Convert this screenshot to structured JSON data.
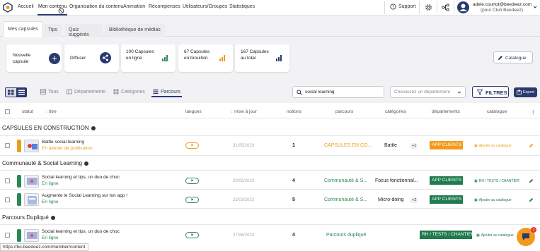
{
  "nav": {
    "links": [
      "Accueil",
      "Mon contenu",
      "Organisation du contenu",
      "Animation",
      "Récompenses",
      "Utilisateurs/Groupes",
      "Statistiques"
    ],
    "support": "Support",
    "user_email": "adele.courtot@beedeez.com",
    "user_club": "(pour Club Beedeez)"
  },
  "tabs": [
    "Mes capsules",
    "Tips",
    "Quiz suggérés",
    "Bibliothèque de médias"
  ],
  "cards": {
    "new_capsule": "Nouvelle capsule",
    "diffuser": "Diffuser",
    "online": "100 Capsules en ligne",
    "draft": "67 Capsules en brouillon",
    "total": "167 Capsules au total",
    "catalogue_btn": "Catalogue"
  },
  "filters": {
    "tabs": [
      "Tous",
      "Départements",
      "Catégories",
      "Parcours"
    ],
    "search_value": "social learning",
    "dept_placeholder": "Choisissez un département",
    "filtres_btn": "FILTRES",
    "export_btn": "Export"
  },
  "table": {
    "headers": [
      "statut",
      "titre",
      "langues",
      "mise à jour",
      "notions",
      "parcours",
      "catégories",
      "départements",
      "catalogue"
    ],
    "sections": [
      {
        "name": "CAPSULES EN CONSTRUCTION",
        "rows": [
          {
            "title": "Battle social learning",
            "status": "En attente de publication",
            "date": "31/05/2023",
            "notions": "1",
            "parcours": "CAPSULES EN CO...",
            "categorie": "Battle",
            "cat_more": "+1",
            "dept": "APP CLIENTS",
            "catalog": "Ajouter au catalogue"
          }
        ]
      },
      {
        "name": "Communauté & Social Learning",
        "rows": [
          {
            "title": "Social learning et tips, un duo de choc",
            "status": "En ligne",
            "date": "30/05/2023",
            "notions": "4",
            "parcours": "Communauté & S...",
            "categorie": "Focus fonctionnal...",
            "cat_more": "",
            "dept": "APP CLIENTS",
            "catalog": "RH / TESTS / CHANTIER"
          },
          {
            "title": "Augmente le Social Learning sur ton app !",
            "status": "En ligne",
            "date": "23/03/2023",
            "notions": "5",
            "parcours": "Communauté & S...",
            "categorie": "Micro-doing",
            "cat_more": "+2",
            "dept": "APP CLIENTS",
            "catalog": "Ajouter au catalogue"
          }
        ]
      },
      {
        "name": "Parcours Dupliqué",
        "rows": [
          {
            "title": "Social learning et tips, un duo de choc",
            "status": "En ligne",
            "date": "27/06/2023",
            "notions": "4",
            "parcours": "Parcours dupliqué",
            "categorie": "",
            "cat_more": "",
            "dept": "RH / TESTS / CHANTIER",
            "catalog": "Ajouter au catalogue"
          }
        ]
      }
    ]
  },
  "statusbar": "https://bo.beedeez.com/member/content",
  "chat_badge": "1",
  "colors": {
    "navy": "#2a3a6e",
    "orange": "#f39a1c",
    "green": "#1f7a4d",
    "status_orange": "#e8a017",
    "status_green": "#2a8a55"
  }
}
